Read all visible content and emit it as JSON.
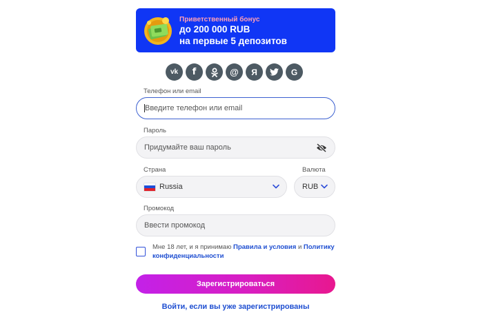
{
  "banner": {
    "small": "Приветственный бонус",
    "line1": "до 200 000 RUB",
    "line2": "на первые 5 депозитов"
  },
  "socials": [
    {
      "name": "vk-icon",
      "glyph": "vk"
    },
    {
      "name": "facebook-icon",
      "glyph": "f"
    },
    {
      "name": "odnoklassniki-icon",
      "glyph": "ok"
    },
    {
      "name": "mail-ru-icon",
      "glyph": "@"
    },
    {
      "name": "yandex-icon",
      "glyph": "Я"
    },
    {
      "name": "twitter-icon",
      "glyph": "tw"
    },
    {
      "name": "google-icon",
      "glyph": "G"
    }
  ],
  "phone": {
    "label": "Телефон или email",
    "placeholder": "Введите телефон или email"
  },
  "password": {
    "label": "Пароль",
    "placeholder": "Придумайте ваш пароль"
  },
  "country": {
    "label": "Страна",
    "value": "Russia"
  },
  "currency": {
    "label": "Валюта",
    "value": "RUB"
  },
  "promo": {
    "label": "Промокод",
    "placeholder": "Ввести промокод"
  },
  "terms": {
    "prefix": "Мне 18 лет, и я принимаю",
    "link1": "Правила и условия",
    "mid": "и",
    "link2": "Политику конфиденциальности"
  },
  "submit_label": "Зарегистрироваться",
  "login_link": "Войти, если вы уже зарегистрированы",
  "colors": {
    "accent": "#1036f5",
    "link": "#1f4fd1",
    "button_from": "#c321e8",
    "button_to": "#e8188f"
  }
}
